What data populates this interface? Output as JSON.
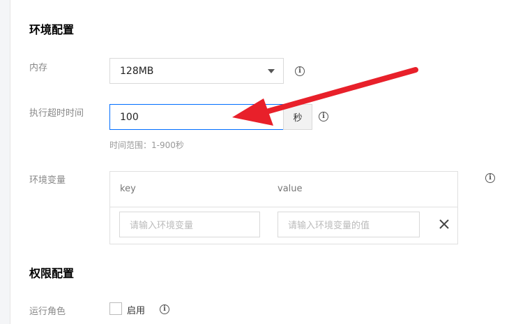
{
  "env_section": {
    "title": "环境配置"
  },
  "memory": {
    "label": "内存",
    "value": "128MB"
  },
  "timeout": {
    "label": "执行超时时间",
    "value": "100",
    "unit": "秒",
    "hint": "时间范围：1-900秒"
  },
  "env_vars": {
    "label": "环境变量",
    "key_header": "key",
    "value_header": "value",
    "key_placeholder": "请输入环境变量",
    "value_placeholder": "请输入环境变量的值"
  },
  "permission_section": {
    "title": "权限配置"
  },
  "role": {
    "label": "运行角色",
    "enable_label": "启用"
  },
  "colors": {
    "accent": "#006eff",
    "annotation_arrow": "#e8202a"
  }
}
